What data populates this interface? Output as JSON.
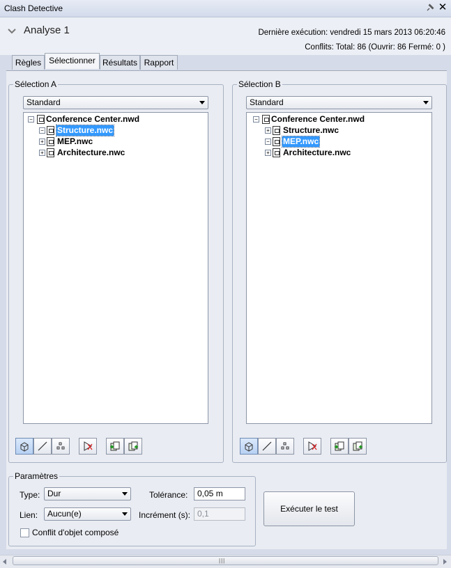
{
  "window": {
    "title": "Clash Detective"
  },
  "header": {
    "analysis_name": "Analyse 1",
    "last_run": "Dernière exécution:  vendredi 15 mars 2013 06:20:46",
    "conflicts": "Conflits:  Total:  86  (Ouvrir:  86  Fermé:  0 )"
  },
  "tabs": [
    "Règles",
    "Sélectionner",
    "Résultats",
    "Rapport"
  ],
  "selection_a": {
    "title": "Sélection A",
    "mode": "Standard",
    "root": "Conference Center.nwd",
    "children": [
      "Structure.nwc",
      "MEP.nwc",
      "Architecture.nwc"
    ],
    "selected_index": 0
  },
  "selection_b": {
    "title": "Sélection B",
    "mode": "Standard",
    "root": "Conference Center.nwd",
    "children": [
      "Structure.nwc",
      "MEP.nwc",
      "Architecture.nwc"
    ],
    "selected_index": 1
  },
  "parameters": {
    "title": "Paramètres",
    "type_label": "Type:",
    "type_value": "Dur",
    "link_label": "Lien:",
    "link_value": "Aucun(e)",
    "tolerance_label": "Tolérance:",
    "tolerance_value": "0,05 m",
    "step_label": "Incrément (s):",
    "step_value": "0,1",
    "composite_label": "Conflit d'objet composé",
    "composite_checked": false
  },
  "run_button": "Exécuter le test"
}
